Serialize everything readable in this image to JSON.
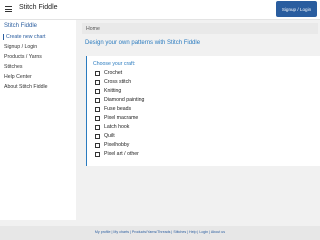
{
  "header": {
    "title": "Stitch Fiddle",
    "menu_icon": "hamburger-icon",
    "signup_label": "Signup / Login"
  },
  "sidebar": {
    "brand": "Stitch Fiddle",
    "items": [
      {
        "label": "Create new chart",
        "active": true
      },
      {
        "label": "Signup / Login"
      },
      {
        "label": "Products / Yarns"
      },
      {
        "label": "Stitches"
      },
      {
        "label": "Help Center"
      },
      {
        "label": "About Stitch Fiddle"
      }
    ]
  },
  "breadcrumb": "Home",
  "main": {
    "title": "Design your own patterns with Stitch Fiddle",
    "choose_label": "Choose your craft:",
    "crafts": [
      "Crochet",
      "Cross stitch",
      "Knitting",
      "Diamond painting",
      "Fuse beads",
      "Pixel macrame",
      "Latch hook",
      "Quilt",
      "Pixelhobby",
      "Pixel art / other"
    ]
  },
  "footer": "My profile | My charts | Products/Yarns/Threads | Stitches | Help | Login | About us",
  "colors": {
    "accent": "#2a7bbf",
    "button": "#2a5d9f"
  }
}
